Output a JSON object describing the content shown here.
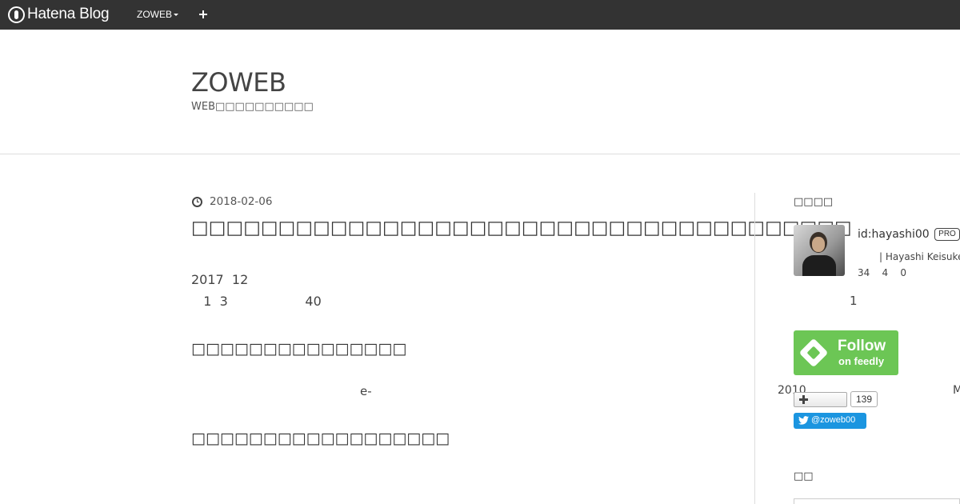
{
  "globalheader": {
    "logo_text": "Hatena Blog",
    "blog_menu_label": "ZOWEB",
    "add_icon": "plus-icon"
  },
  "blog": {
    "title": "ZOWEB",
    "description": "WEB□□□□□□□□□□"
  },
  "entry": {
    "date_icon": "clock-icon",
    "date": "2018-02-06",
    "title": "□□□□□□□□□□□□□□□□□□□□□□□□□□□□□□□□□□□□□□",
    "paragraph_1": "2017  12",
    "paragraph_2": "   1  3                   40",
    "heading_1": "□□□□□□□□□□□□□□□",
    "paragraph_3": "e-",
    "heading_2": "□□□□□□□□□□□□□□□□□□"
  },
  "sidebar": {
    "profile_title": "□□□□",
    "profile_id": "id:hayashi00",
    "pro_badge": "PRO",
    "profile_name": "| Hayashi Keisuke",
    "profile_stats": "34    4    0",
    "profile_extra": "1",
    "feedly_follow": "Follow",
    "feedly_sub": "on feedly",
    "year_text": "2010",
    "m_text": "M",
    "subscribe_count": "139",
    "twitter_label": "@zoweb00",
    "search_title": "□□"
  },
  "colors": {
    "header_bg": "#333333",
    "feedly_green": "#6cc655",
    "twitter_blue": "#1b95e0"
  }
}
